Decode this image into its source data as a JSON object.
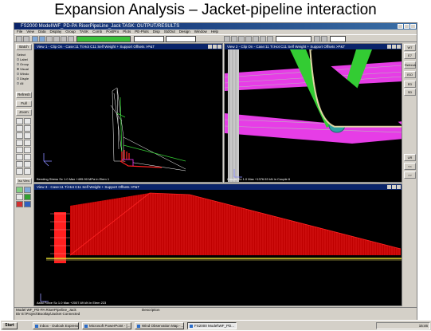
{
  "slide": {
    "title": "Expansion Analysis – Jacket-pipeline interaction"
  },
  "window": {
    "title": "FS2000 Model\\WF_PD-PA RiserPipeLine_Jack TASK: OUTPUT/RESULTS"
  },
  "menu": {
    "items": [
      "File",
      "View",
      "Data",
      "Display",
      "Group",
      "TASK",
      "Comb",
      "PostPro",
      "Plots",
      "PE-Plots",
      "Disp",
      "StdOut",
      "Design",
      "Window",
      "Help"
    ]
  },
  "toolbar": {
    "node_field": "",
    "aux_field_1": "",
    "aux_field_2": "",
    "combo_field": "",
    "input_field": ""
  },
  "sidebar": {
    "batch": "Batch",
    "select_label": "Select",
    "radios": [
      "Label",
      "Group",
      "Visual",
      "Windo",
      "Disple",
      "All"
    ],
    "refresh": "Refresh",
    "full": "Full",
    "zoom": "Zoom",
    "iso_view": "Iso View"
  },
  "views": [
    {
      "title": "View 1 - Clip On - Case:11 Ti:Hot C11 Self Weight + Support Offsets >P&T",
      "status": "Bending Stress Sc 1.0 Max +495.90 MPa in Elem 1"
    },
    {
      "title": "View 2 - Clip On - Case:11 Ti:Hot C11 Self Weight + Support Offsets >P&T",
      "status": "Couple Sc 1.0 Max +1376.53 kN in Couple 6"
    },
    {
      "title": "View 3 - Case:11 Ti:Hot C11 Self Weight + Support Offsets >P&T",
      "status": "Axial Force Sc 1.0 Max +2007.69 kN in Elem 223"
    }
  ],
  "rightbar": {
    "buttons": [
      "W7",
      "E7",
      "Refresh",
      "ISO",
      "ED",
      "SD",
      "UR",
      "<<",
      ">>"
    ]
  },
  "status": {
    "model_label": "Model",
    "model_value": "WF_PD-PA RiserPipeline_Jack",
    "dir_label": "Dir",
    "dir_value": "E:\\Project\\Bootlap\\Jacket Connected",
    "description_label": "Description"
  },
  "taskbar": {
    "start": "Start",
    "tasks": [
      "Inbox - Outlook Express",
      "Microsoft PowerPoint - [...",
      "Wind Observation Map -...",
      "FS2000 Model\\WF_PD..."
    ],
    "clock": "15:46"
  },
  "colors": {
    "viewport_bg": "#000000",
    "title_active": "#0a246a",
    "pipe_green": "#33cc33",
    "pipe_magenta": "#ff33ff",
    "force_red": "#ff0000",
    "seabed_yellow": "#ffff33"
  }
}
